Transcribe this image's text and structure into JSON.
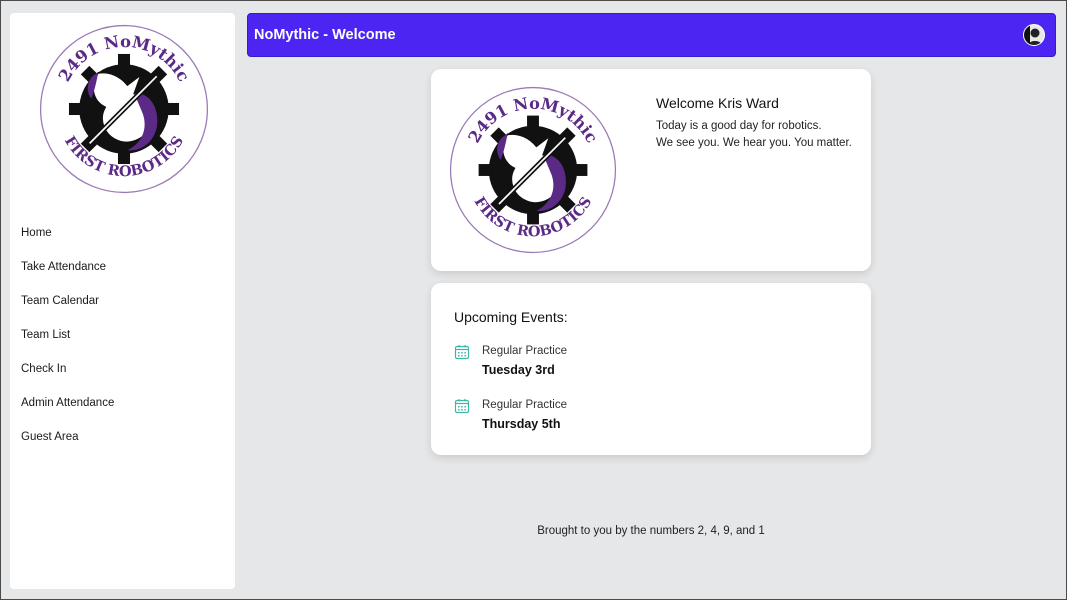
{
  "header": {
    "title": "NoMythic - Welcome",
    "bar_color": "#4c25f2",
    "avatar_icon": "user-avatar-icon"
  },
  "logo": {
    "arc_top": "2491 NoMythic",
    "arc_bottom": "FIRST ROBOTICS",
    "icon": "unicorn-gear-logo-icon",
    "accent": "#5b2a86"
  },
  "sidebar": {
    "items": [
      {
        "label": "Home"
      },
      {
        "label": "Take Attendance"
      },
      {
        "label": "Team Calendar"
      },
      {
        "label": "Team List"
      },
      {
        "label": "Check In"
      },
      {
        "label": "Admin Attendance"
      },
      {
        "label": "Guest Area"
      }
    ]
  },
  "welcome": {
    "title": "Welcome Kris Ward",
    "line1": "Today is a good day for robotics.",
    "line2": "We see you. We hear you. You matter."
  },
  "events": {
    "title": "Upcoming Events:",
    "icon": "calendar-icon",
    "icon_color": "#3fb6a8",
    "items": [
      {
        "name": "Regular Practice",
        "day": "Tuesday 3rd"
      },
      {
        "name": "Regular Practice",
        "day": "Thursday 5th"
      }
    ]
  },
  "footer": {
    "text": "Brought to you by the numbers 2, 4, 9, and 1"
  }
}
